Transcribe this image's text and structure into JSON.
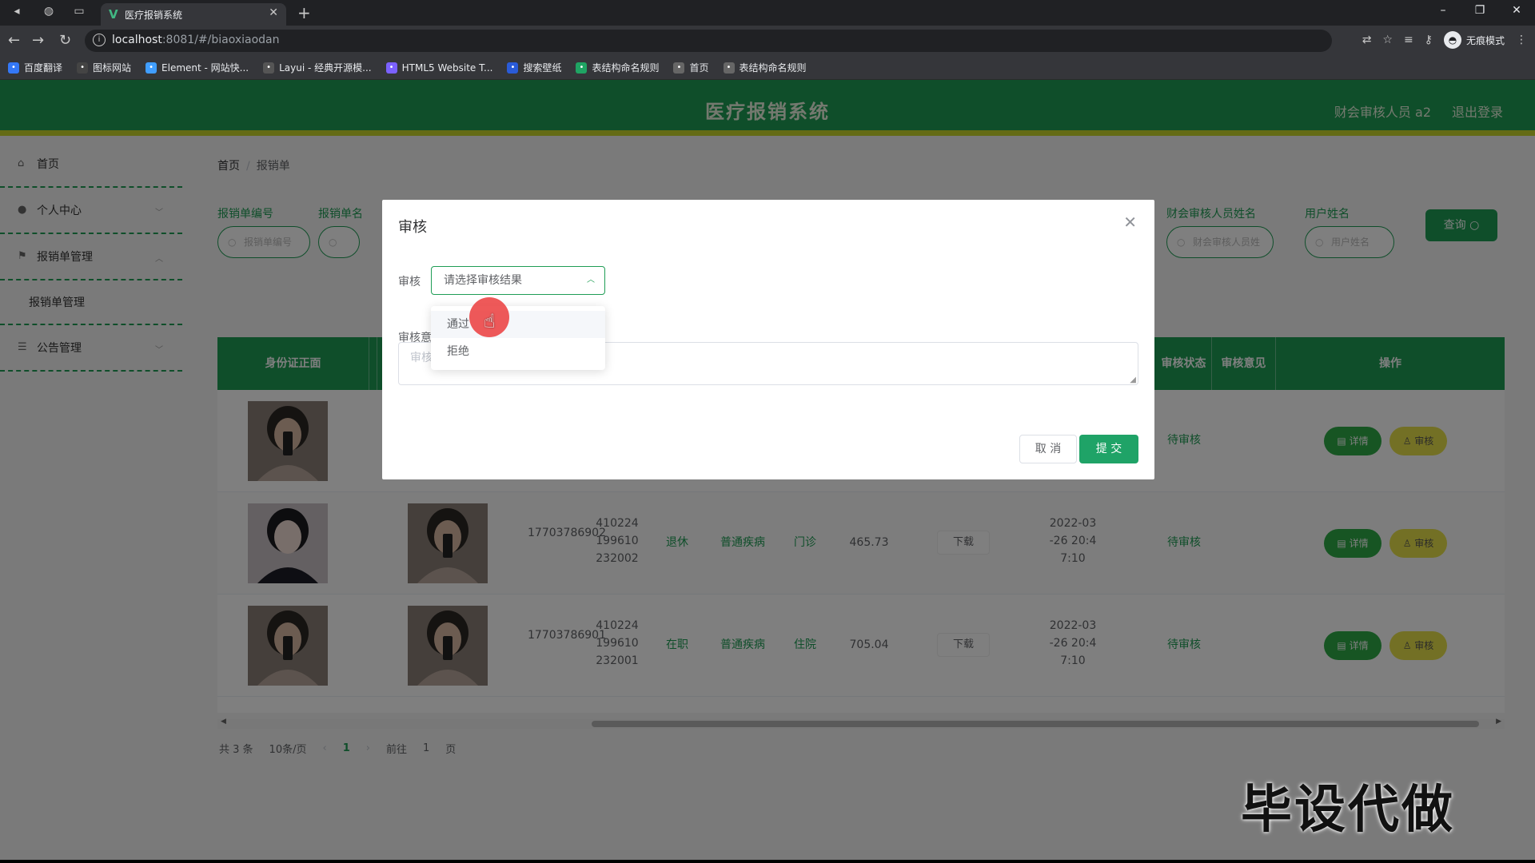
{
  "browser": {
    "tab_title": "医疗报销系统",
    "url_host": "localhost",
    "url_rest": ":8081/#/biaoxiaodan",
    "profile_label": "无痕模式",
    "bookmarks": [
      {
        "label": "百度翻译",
        "color": "#3478f6"
      },
      {
        "label": "图标网站",
        "color": "#444444"
      },
      {
        "label": "Element - 网站快...",
        "color": "#409eff"
      },
      {
        "label": "Layui - 经典开源模...",
        "color": "#555555"
      },
      {
        "label": "HTML5 Website T...",
        "color": "#7b61ff"
      },
      {
        "label": "搜索壁纸",
        "color": "#2a5bd7"
      },
      {
        "label": "表结构命名规则",
        "color": "#1fa463"
      },
      {
        "label": "首页",
        "color": "#666666"
      },
      {
        "label": "表结构命名规则",
        "color": "#666666"
      }
    ]
  },
  "app": {
    "title": "医疗报销系统",
    "user_label": "财会审核人员 a2",
    "logout_label": "退出登录",
    "accent_color": "#1f9d55"
  },
  "sidebar": {
    "items": [
      {
        "label": "首页",
        "icon": "home-icon"
      },
      {
        "label": "个人中心",
        "icon": "user-icon"
      },
      {
        "label": "报销单管理",
        "icon": "flag-icon"
      },
      {
        "label": "报销单管理",
        "icon": ""
      },
      {
        "label": "公告管理",
        "icon": "list-icon"
      }
    ]
  },
  "breadcrumb": {
    "home": "首页",
    "current": "报销单"
  },
  "filters": {
    "f1_label": "报销单编号",
    "f1_placeholder": "报销单编号",
    "f2_label": "报销单名",
    "f3_label": "财会审核人员姓名",
    "f3_placeholder": "财会审核人员姓",
    "f4_label": "用户姓名",
    "f4_placeholder": "用户姓名",
    "query_label": "查询 ○"
  },
  "table": {
    "headers": {
      "id_front": "身份证正面",
      "status": "审核状态",
      "opinion": "审核意见",
      "action": "操作"
    },
    "rows": [
      {
        "phone": "",
        "idno": "",
        "job": "",
        "disease": "",
        "type": "",
        "amount": "",
        "download": "",
        "time": "",
        "status": "待审核",
        "detail_label": "详情",
        "audit_label": "审核"
      },
      {
        "phone": "17703786902",
        "idno": "410224199610232002",
        "job": "退休",
        "disease": "普通疾病",
        "type": "门诊",
        "amount": "465.73",
        "download": "下载",
        "time": "2022-03-26 20:47:10",
        "status": "待审核",
        "detail_label": "详情",
        "audit_label": "审核"
      },
      {
        "phone": "17703786901",
        "idno": "410224199610232001",
        "job": "在职",
        "disease": "普通疾病",
        "type": "住院",
        "amount": "705.04",
        "download": "下载",
        "time": "2022-03-26 20:47:10",
        "status": "待审核",
        "detail_label": "详情",
        "audit_label": "审核"
      }
    ]
  },
  "pager": {
    "total": "共 3 条",
    "size": "10条/页",
    "current": "1",
    "goto": "前往",
    "goto_value": "1",
    "page_unit": "页"
  },
  "dialog": {
    "title": "审核",
    "audit_label": "审核",
    "select_placeholder": "请选择审核结果",
    "options": [
      "通过",
      "拒绝"
    ],
    "opinion_label": "审核意",
    "opinion_placeholder": "审核",
    "cancel_label": "取 消",
    "submit_label": "提 交"
  },
  "watermark": "毕设代做"
}
